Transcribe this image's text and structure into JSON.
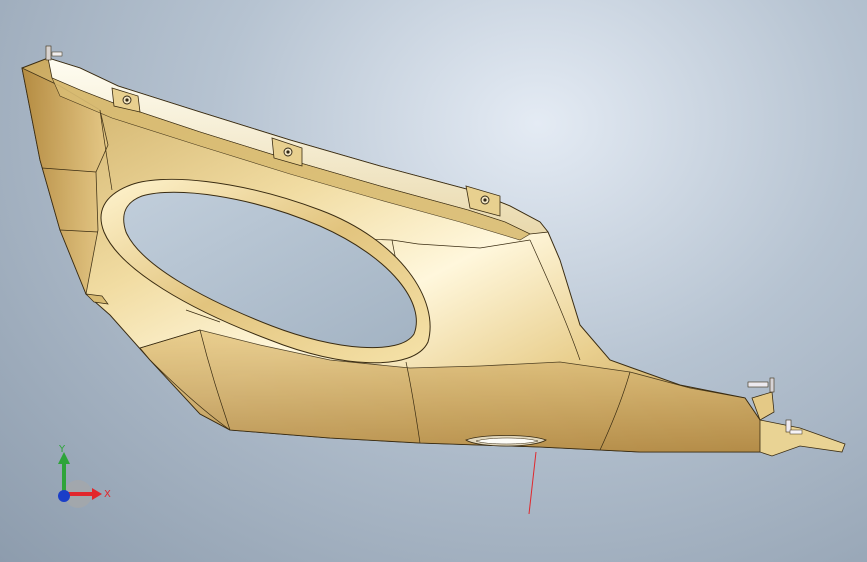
{
  "viewport": {
    "background_top": "#e4ebf4",
    "background_bottom": "#8d9cad"
  },
  "model": {
    "body_color": "#dcc27f",
    "edge_color": "#2e2412",
    "highlight_color": "#fffbe8",
    "shadow_color": "#8c6a30"
  },
  "triad": {
    "x_label": "X",
    "y_label": "Y",
    "x_color": "#e2262b",
    "y_color": "#2ea43a",
    "z_color": "#1a3ec8"
  }
}
